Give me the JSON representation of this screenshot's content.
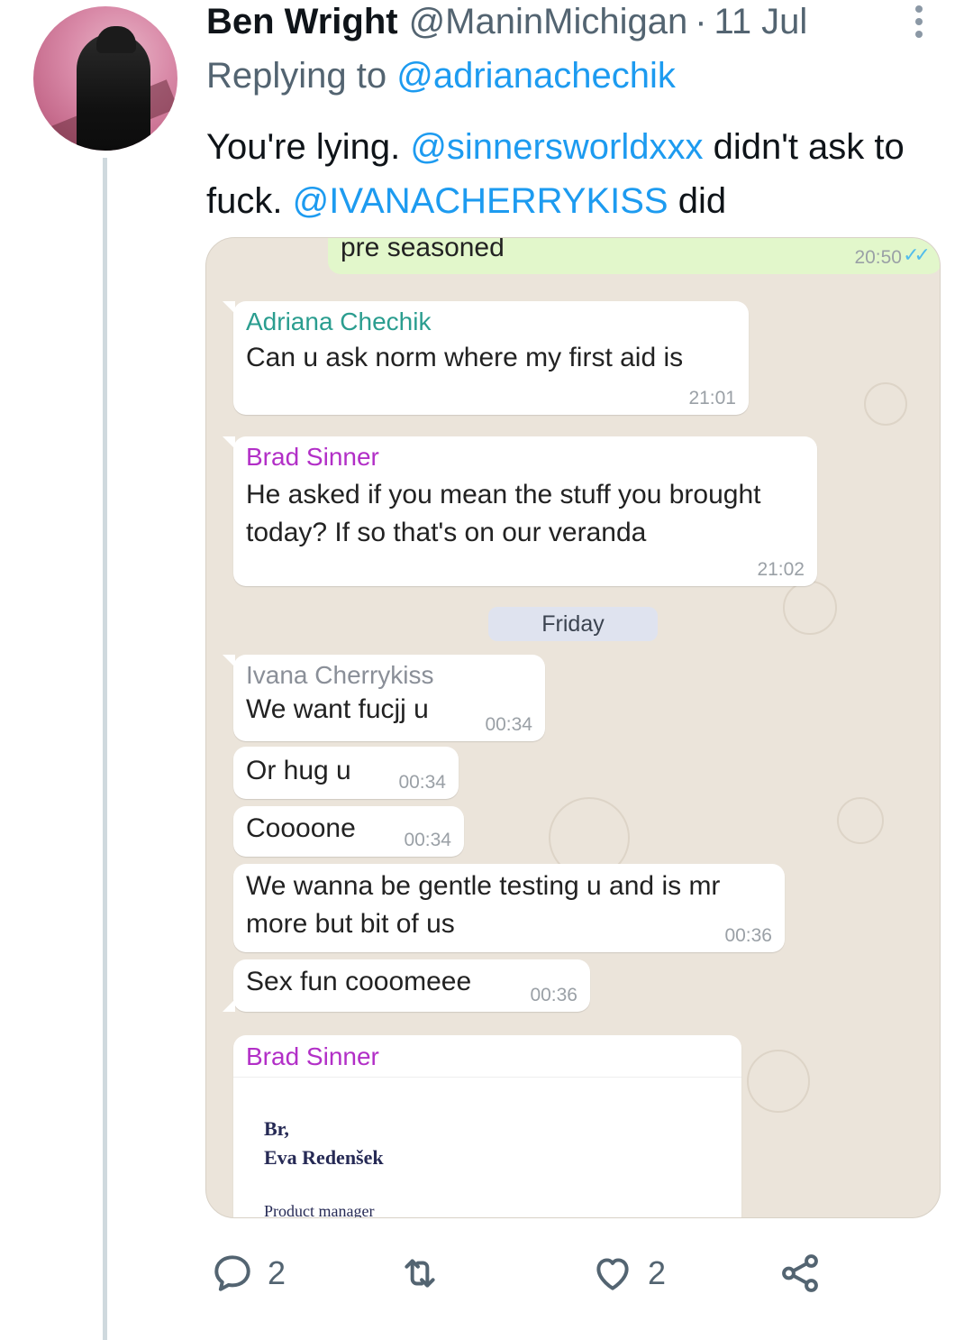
{
  "tweet": {
    "author_name": "Ben Wright",
    "author_handle": "@ManinMichigan",
    "separator": "·",
    "date": "11 Jul",
    "replying_prefix": "Replying to",
    "replying_to": "@adrianachechik",
    "text_part1": "You're lying. ",
    "mention1": "@sinnersworldxxx",
    "text_part2": " didn't ask to fuck. ",
    "mention2": "@IVANACHERRYKISS",
    "text_part3": " did"
  },
  "chat": {
    "outgoing": {
      "text": "pre seasoned",
      "time": "20:50",
      "ticks": "✓✓"
    },
    "messages": [
      {
        "sender": "Adriana  Chechik",
        "sender_color": "#2a9d8f",
        "text": "Can u ask norm where my first aid is",
        "time": "21:01"
      },
      {
        "sender": "Brad Sinner",
        "sender_color": "#b22fc7",
        "text": "He asked if you mean the stuff you brought today? If so that's on our veranda",
        "time": "21:02"
      },
      {
        "sender": "Ivana  Cherrykiss",
        "sender_color": "#8a8f98",
        "text": "We want fucjj u",
        "time": "00:34"
      },
      {
        "text": "Or hug u",
        "time": "00:34"
      },
      {
        "text": "Coooone",
        "time": "00:34"
      },
      {
        "text": "We  wanna be gentle testing u and is mr more but bit of us",
        "time": "00:36"
      },
      {
        "text": "Sex fun cooomeee",
        "time": "00:36"
      }
    ],
    "day_separator": "Friday",
    "card": {
      "sender": "Brad Sinner",
      "line1": "Br,",
      "line2": "Eva Redenšek",
      "line3": "Product manager"
    }
  },
  "actions": {
    "reply_count": "2",
    "retweet_count": "",
    "like_count": "2"
  },
  "icons": [
    "more-icon",
    "reply-icon",
    "retweet-icon",
    "like-icon",
    "share-icon",
    "double-check-icon"
  ],
  "colors": {
    "mention": "#1d9bf0",
    "secondary_text": "#536471",
    "chat_bg": "#ebe4da",
    "outgoing_bubble": "#e2f7cb"
  }
}
